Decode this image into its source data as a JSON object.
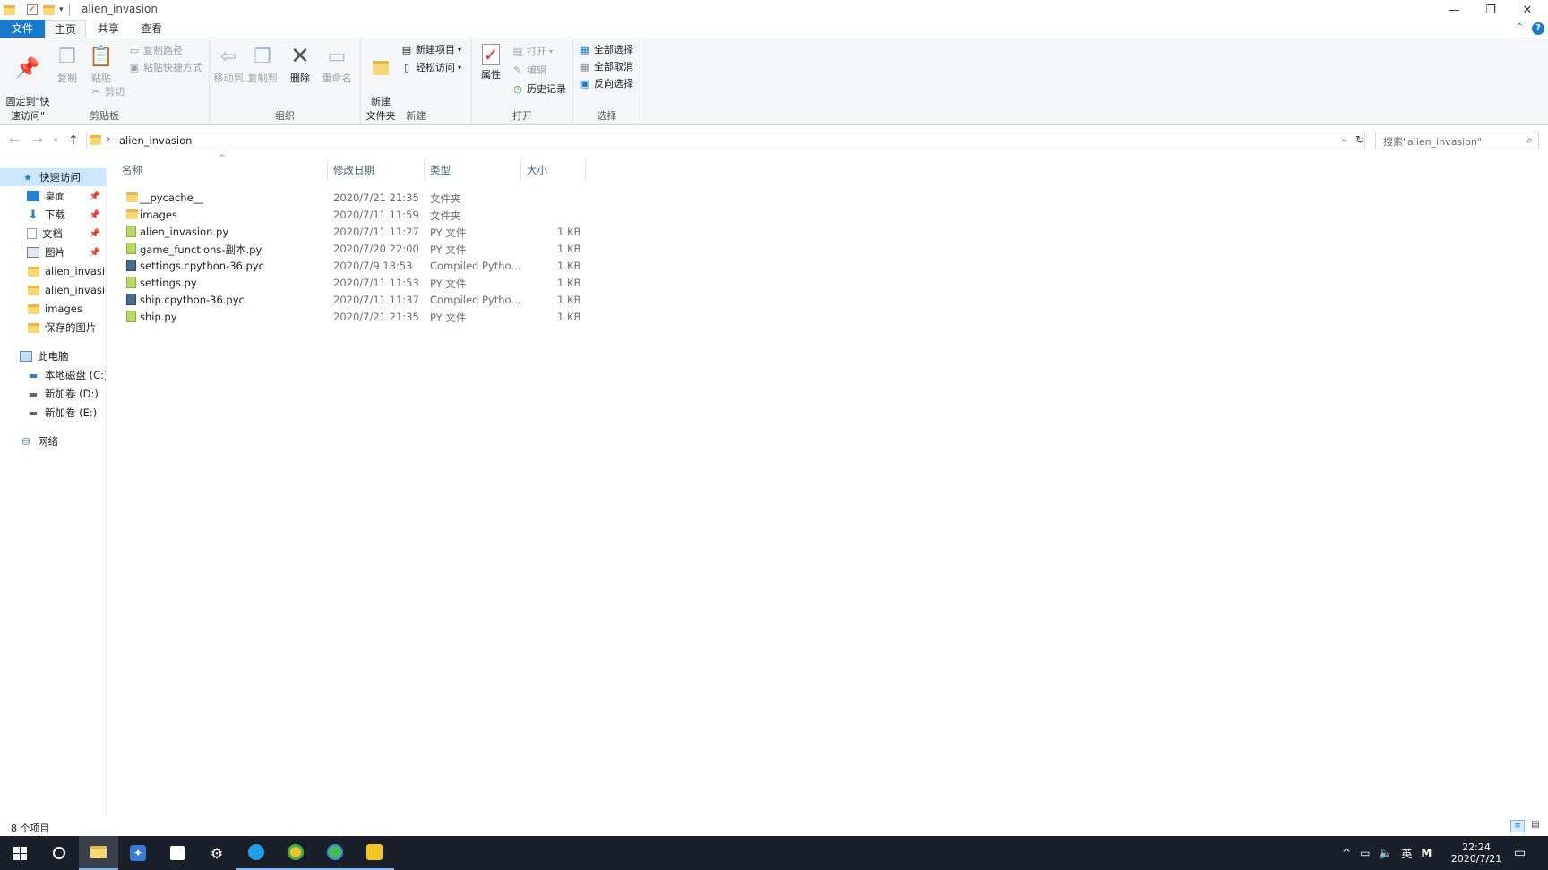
{
  "window": {
    "title": "alien_invasion",
    "minimize_glyph": "—",
    "restore_glyph": "❐",
    "close_glyph": "✕"
  },
  "ribbon_tabs": [
    "文件",
    "主页",
    "共享",
    "查看"
  ],
  "ribbon": {
    "clipboard": {
      "label": "剪贴板",
      "pin": "固定到\"快\n速访问\"",
      "copy": "复制",
      "paste": "粘贴",
      "copy_path": "复制路径",
      "paste_shortcut": "粘贴快捷方式",
      "cut": "剪切"
    },
    "organize": {
      "label": "组织",
      "move_to": "移动到",
      "copy_to": "复制到",
      "delete": "删除",
      "rename": "重命名"
    },
    "new": {
      "label": "新建",
      "new_folder": "新建\n文件夹",
      "new_item": "新建项目",
      "easy_access": "轻松访问"
    },
    "open": {
      "label": "打开",
      "properties": "属性",
      "open": "打开",
      "edit": "编辑",
      "history": "历史记录"
    },
    "select": {
      "label": "选择",
      "select_all": "全部选择",
      "select_none": "全部取消",
      "invert": "反向选择"
    }
  },
  "address": {
    "path": "alien_invasion",
    "search_placeholder": "搜索\"alien_invasion\""
  },
  "nav": {
    "quick_access": "快速访问",
    "items": [
      "桌面",
      "下载",
      "文档",
      "图片",
      "alien_invasion",
      "alien_invasion",
      "images",
      "保存的图片"
    ],
    "this_pc": "此电脑",
    "drives": [
      "本地磁盘 (C:)",
      "新加卷 (D:)",
      "新加卷 (E:)"
    ],
    "network": "网络"
  },
  "columns": [
    "名称",
    "修改日期",
    "类型",
    "大小"
  ],
  "files": [
    {
      "name": "__pycache__",
      "date": "2020/7/21 21:35",
      "type": "文件夹",
      "size": "",
      "kind": "folder"
    },
    {
      "name": "images",
      "date": "2020/7/11 11:59",
      "type": "文件夹",
      "size": "",
      "kind": "folder"
    },
    {
      "name": "alien_invasion.py",
      "date": "2020/7/11 11:27",
      "type": "PY 文件",
      "size": "1 KB",
      "kind": "py"
    },
    {
      "name": "game_functions-副本.py",
      "date": "2020/7/20 22:00",
      "type": "PY 文件",
      "size": "1 KB",
      "kind": "py"
    },
    {
      "name": "settings.cpython-36.pyc",
      "date": "2020/7/9 18:53",
      "type": "Compiled Pytho...",
      "size": "1 KB",
      "kind": "pyc"
    },
    {
      "name": "settings.py",
      "date": "2020/7/11 11:53",
      "type": "PY 文件",
      "size": "1 KB",
      "kind": "py"
    },
    {
      "name": "ship.cpython-36.pyc",
      "date": "2020/7/11 11:37",
      "type": "Compiled Pytho...",
      "size": "1 KB",
      "kind": "pyc"
    },
    {
      "name": "ship.py",
      "date": "2020/7/21 21:35",
      "type": "PY 文件",
      "size": "1 KB",
      "kind": "py"
    }
  ],
  "status": {
    "item_count": "8 个项目"
  },
  "taskbar": {
    "ime": "英",
    "ime2": "M",
    "time": "22:24",
    "date": "2020/7/21"
  },
  "colors": {
    "accent": "#1979ca",
    "selection": "#cce8ff",
    "taskbar": "#1b1f2a"
  }
}
